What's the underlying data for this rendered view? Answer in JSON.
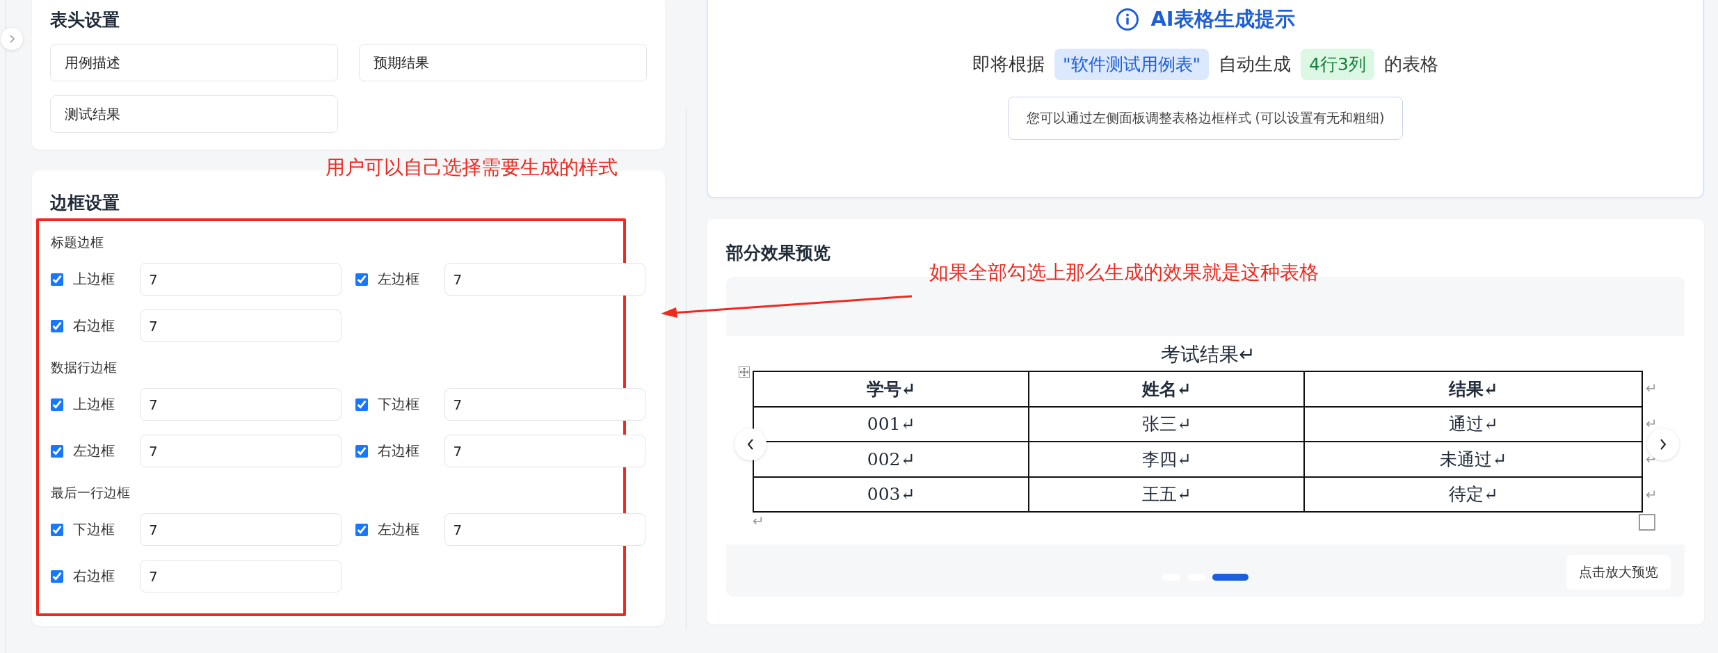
{
  "header_settings": {
    "title": "表头设置",
    "fields": [
      {
        "value": "用例描述"
      },
      {
        "value": "预期结果"
      },
      {
        "value": "测试结果"
      }
    ]
  },
  "border_settings": {
    "title": "边框设置",
    "groups": [
      {
        "label": "标题边框",
        "items": [
          {
            "label": "上边框",
            "checked": true,
            "value": "7"
          },
          {
            "label": "左边框",
            "checked": true,
            "value": "7"
          },
          {
            "label": "右边框",
            "checked": true,
            "value": "7"
          }
        ]
      },
      {
        "label": "数据行边框",
        "items": [
          {
            "label": "上边框",
            "checked": true,
            "value": "7"
          },
          {
            "label": "下边框",
            "checked": true,
            "value": "7"
          },
          {
            "label": "左边框",
            "checked": true,
            "value": "7"
          },
          {
            "label": "右边框",
            "checked": true,
            "value": "7"
          }
        ]
      },
      {
        "label": "最后一行边框",
        "items": [
          {
            "label": "下边框",
            "checked": true,
            "value": "7"
          },
          {
            "label": "左边框",
            "checked": true,
            "value": "7"
          },
          {
            "label": "右边框",
            "checked": true,
            "value": "7"
          }
        ]
      }
    ]
  },
  "prompt_card": {
    "title": "AI表格生成提示",
    "text_before": "即将根据",
    "source_tag": "\"软件测试用例表\"",
    "text_middle": "自动生成",
    "size_tag": "4行3列",
    "text_after": "的表格",
    "hint": "您可以通过左侧面板调整表格边框样式 (可以设置有无和粗细)"
  },
  "preview": {
    "title": "部分效果预览",
    "document": {
      "title": "考试结果↵",
      "columns": [
        "学号↵",
        "姓名↵",
        "结果↵"
      ],
      "rows": [
        [
          "001↵",
          "张三↵",
          "通过↵"
        ],
        [
          "002↵",
          "李四↵",
          "未通过↵"
        ],
        [
          "003↵",
          "王五↵",
          "待定↵"
        ]
      ],
      "row_marks": [
        "↵",
        "↵",
        "↵",
        "↵"
      ],
      "end_mark": "↵"
    },
    "dots": [
      {
        "selected": false
      },
      {
        "selected": false
      },
      {
        "selected": true
      }
    ],
    "zoom_button": "点击放大预览"
  },
  "annotations": [
    {
      "text": "用户可以自己选择需要生成的样式"
    },
    {
      "text": "如果全部勾选上那么生成的效果就是这种表格"
    }
  ]
}
